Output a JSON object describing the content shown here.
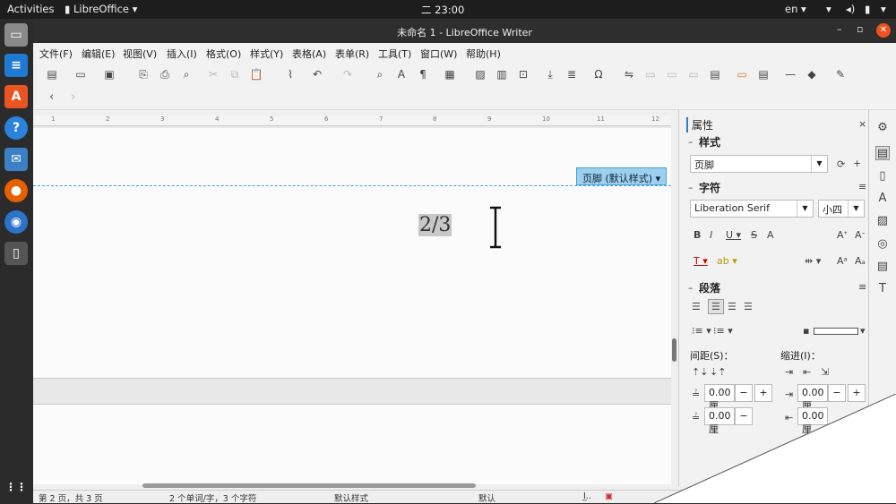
{
  "topbar": {
    "activities": "Activities",
    "app": "LibreOffice",
    "clock": "二 23:00",
    "lang": "en"
  },
  "window": {
    "title": "未命名 1 - LibreOffice Writer"
  },
  "menu": [
    "文件(F)",
    "编辑(E)",
    "视图(V)",
    "插入(I)",
    "格式(O)",
    "样式(Y)",
    "表格(A)",
    "表单(R)",
    "工具(T)",
    "窗口(W)",
    "帮助(H)"
  ],
  "document": {
    "footer_tag": "页脚 (默认样式)",
    "page_number": "2/3"
  },
  "sidebar": {
    "title": "属性",
    "styles_header": "样式",
    "style_value": "页脚",
    "char_header": "字符",
    "font_name": "Liberation Serif",
    "font_size": "小四",
    "para_header": "段落",
    "spacing_label": "间距(S)：",
    "indent_label": "缩进(I)：",
    "spacing_value_1": "0.00 厘",
    "spacing_value_2": "0.00 厘",
    "indent_value_1": "0.00 厘",
    "indent_value_2": "0.00 厘"
  },
  "status": {
    "page": "第 2 页，共 3 页",
    "words": "2 个单词/字，3 个字符",
    "page_style": "默认样式",
    "language": "默认"
  }
}
